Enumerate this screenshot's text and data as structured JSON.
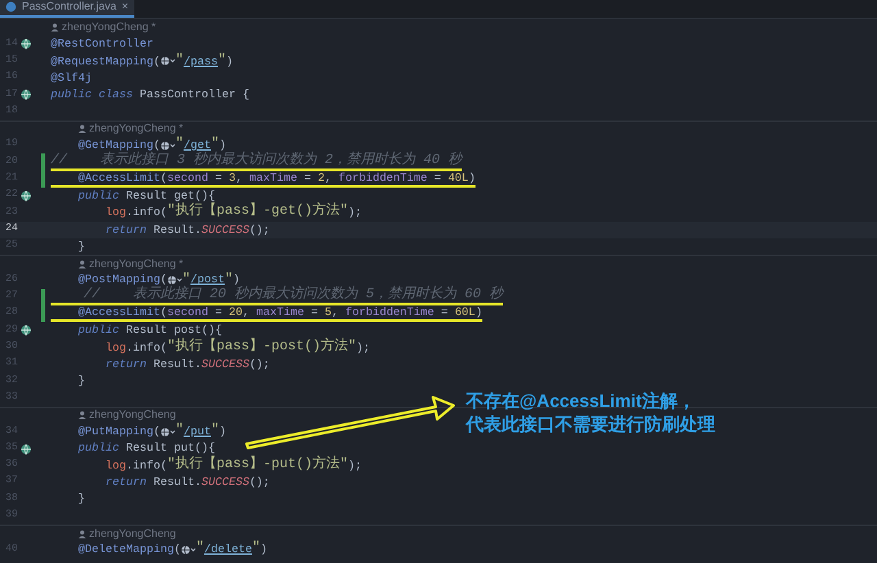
{
  "tab": {
    "title": "PassController.java",
    "close": "×"
  },
  "lines": [
    {
      "kind": "author",
      "text": "zhengYongCheng *"
    },
    {
      "kind": "code",
      "number": "14",
      "gutter_icon": true,
      "tokens": [
        {
          "kind": "annotation",
          "text": "@RestController"
        }
      ]
    },
    {
      "kind": "code",
      "number": "15",
      "tokens": [
        {
          "kind": "annotation",
          "text": "@RequestMapping"
        },
        {
          "kind": "plain",
          "text": "("
        },
        {
          "kind": "url_icon"
        },
        {
          "kind": "string",
          "text": "\""
        },
        {
          "kind": "link",
          "text": "/pass"
        },
        {
          "kind": "string",
          "text": "\""
        },
        {
          "kind": "plain",
          "text": ")"
        }
      ]
    },
    {
      "kind": "code",
      "number": "16",
      "tokens": [
        {
          "kind": "annotation",
          "text": "@Slf4j"
        }
      ]
    },
    {
      "kind": "code",
      "number": "17",
      "gutter_icon": true,
      "tokens": [
        {
          "kind": "keyword",
          "text": "public class "
        },
        {
          "kind": "plain",
          "text": "PassController {"
        }
      ]
    },
    {
      "kind": "code",
      "number": "18"
    },
    {
      "kind": "author",
      "text": "zhengYongCheng *"
    },
    {
      "kind": "code",
      "number": "19",
      "tokens": [
        {
          "kind": "annotation",
          "text": "    @GetMapping"
        },
        {
          "kind": "plain",
          "text": "("
        },
        {
          "kind": "url_icon"
        },
        {
          "kind": "string",
          "text": "\""
        },
        {
          "kind": "link",
          "text": "/get"
        },
        {
          "kind": "string",
          "text": "\""
        },
        {
          "kind": "plain",
          "text": ")"
        }
      ]
    },
    {
      "kind": "code",
      "number": "20",
      "changed": true,
      "underlined": true,
      "tokens": [
        {
          "kind": "comment",
          "text": "//    表示此接口 3 秒内最大访问次数为 2，禁用时长为 40 秒"
        }
      ]
    },
    {
      "kind": "code",
      "number": "21",
      "changed": true,
      "underlined": true,
      "tokens": [
        {
          "kind": "annotation",
          "text": "    @AccessLimit"
        },
        {
          "kind": "plain",
          "text": "("
        },
        {
          "kind": "param",
          "text": "second"
        },
        {
          "kind": "plain",
          "text": " = "
        },
        {
          "kind": "number",
          "text": "3"
        },
        {
          "kind": "plain",
          "text": ", "
        },
        {
          "kind": "param",
          "text": "maxTime"
        },
        {
          "kind": "plain",
          "text": " = "
        },
        {
          "kind": "number",
          "text": "2"
        },
        {
          "kind": "plain",
          "text": ", "
        },
        {
          "kind": "param",
          "text": "forbiddenTime"
        },
        {
          "kind": "plain",
          "text": " = "
        },
        {
          "kind": "number",
          "text": "40L"
        },
        {
          "kind": "plain",
          "text": ")"
        }
      ]
    },
    {
      "kind": "code",
      "number": "22",
      "gutter_icon": true,
      "tokens": [
        {
          "kind": "keyword",
          "text": "    public "
        },
        {
          "kind": "plain",
          "text": "Result get(){"
        }
      ]
    },
    {
      "kind": "code",
      "number": "23",
      "tokens": [
        {
          "kind": "field",
          "text": "        log"
        },
        {
          "kind": "plain",
          "text": ".info("
        },
        {
          "kind": "string",
          "text": "\"执行【pass】-get()方法\""
        },
        {
          "kind": "plain",
          "text": ");"
        }
      ]
    },
    {
      "kind": "code",
      "number": "24",
      "current": true,
      "tokens": [
        {
          "kind": "keyword",
          "text": "        return "
        },
        {
          "kind": "plain",
          "text": "Result."
        },
        {
          "kind": "constant",
          "text": "SUCCESS"
        },
        {
          "kind": "plain",
          "text": "();"
        }
      ]
    },
    {
      "kind": "code",
      "number": "25",
      "tokens": [
        {
          "kind": "plain",
          "text": "    }"
        }
      ]
    },
    {
      "kind": "author",
      "text": "zhengYongCheng *"
    },
    {
      "kind": "code",
      "number": "26",
      "tokens": [
        {
          "kind": "annotation",
          "text": "    @PostMapping"
        },
        {
          "kind": "plain",
          "text": "("
        },
        {
          "kind": "url_icon"
        },
        {
          "kind": "string",
          "text": "\""
        },
        {
          "kind": "link",
          "text": "/post"
        },
        {
          "kind": "string",
          "text": "\""
        },
        {
          "kind": "plain",
          "text": ")"
        }
      ]
    },
    {
      "kind": "code",
      "number": "27",
      "changed": true,
      "underlined": true,
      "tokens": [
        {
          "kind": "comment",
          "text": "    //    表示此接口 20 秒内最大访问次数为 5，禁用时长为 60 秒"
        }
      ]
    },
    {
      "kind": "code",
      "number": "28",
      "changed": true,
      "underlined": true,
      "tokens": [
        {
          "kind": "annotation",
          "text": "    @AccessLimit"
        },
        {
          "kind": "plain",
          "text": "("
        },
        {
          "kind": "param",
          "text": "second"
        },
        {
          "kind": "plain",
          "text": " = "
        },
        {
          "kind": "number",
          "text": "20"
        },
        {
          "kind": "plain",
          "text": ", "
        },
        {
          "kind": "param",
          "text": "maxTime"
        },
        {
          "kind": "plain",
          "text": " = "
        },
        {
          "kind": "number",
          "text": "5"
        },
        {
          "kind": "plain",
          "text": ", "
        },
        {
          "kind": "param",
          "text": "forbiddenTime"
        },
        {
          "kind": "plain",
          "text": " = "
        },
        {
          "kind": "number",
          "text": "60L"
        },
        {
          "kind": "plain",
          "text": ")"
        }
      ]
    },
    {
      "kind": "code",
      "number": "29",
      "gutter_icon": true,
      "tokens": [
        {
          "kind": "keyword",
          "text": "    public "
        },
        {
          "kind": "plain",
          "text": "Result post(){"
        }
      ]
    },
    {
      "kind": "code",
      "number": "30",
      "tokens": [
        {
          "kind": "field",
          "text": "        log"
        },
        {
          "kind": "plain",
          "text": ".info("
        },
        {
          "kind": "string",
          "text": "\"执行【pass】-post()方法\""
        },
        {
          "kind": "plain",
          "text": ");"
        }
      ]
    },
    {
      "kind": "code",
      "number": "31",
      "tokens": [
        {
          "kind": "keyword",
          "text": "        return "
        },
        {
          "kind": "plain",
          "text": "Result."
        },
        {
          "kind": "constant",
          "text": "SUCCESS"
        },
        {
          "kind": "plain",
          "text": "();"
        }
      ]
    },
    {
      "kind": "code",
      "number": "32",
      "tokens": [
        {
          "kind": "plain",
          "text": "    }"
        }
      ]
    },
    {
      "kind": "code",
      "number": "33"
    },
    {
      "kind": "author",
      "text": "zhengYongCheng"
    },
    {
      "kind": "code",
      "number": "34",
      "tokens": [
        {
          "kind": "annotation",
          "text": "    @PutMapping"
        },
        {
          "kind": "plain",
          "text": "("
        },
        {
          "kind": "url_icon"
        },
        {
          "kind": "string",
          "text": "\""
        },
        {
          "kind": "link",
          "text": "/put"
        },
        {
          "kind": "string",
          "text": "\""
        },
        {
          "kind": "plain",
          "text": ")"
        }
      ]
    },
    {
      "kind": "code",
      "number": "35",
      "gutter_icon": true,
      "tokens": [
        {
          "kind": "keyword",
          "text": "    public "
        },
        {
          "kind": "plain",
          "text": "Result put(){"
        }
      ]
    },
    {
      "kind": "code",
      "number": "36",
      "tokens": [
        {
          "kind": "field",
          "text": "        log"
        },
        {
          "kind": "plain",
          "text": ".info("
        },
        {
          "kind": "string",
          "text": "\"执行【pass】-put()方法\""
        },
        {
          "kind": "plain",
          "text": ");"
        }
      ]
    },
    {
      "kind": "code",
      "number": "37",
      "tokens": [
        {
          "kind": "keyword",
          "text": "        return "
        },
        {
          "kind": "plain",
          "text": "Result."
        },
        {
          "kind": "constant",
          "text": "SUCCESS"
        },
        {
          "kind": "plain",
          "text": "();"
        }
      ]
    },
    {
      "kind": "code",
      "number": "38",
      "tokens": [
        {
          "kind": "plain",
          "text": "    }"
        }
      ]
    },
    {
      "kind": "code",
      "number": "39"
    },
    {
      "kind": "author",
      "text": "zhengYongCheng"
    },
    {
      "kind": "code",
      "number": "40",
      "tokens": [
        {
          "kind": "annotation",
          "text": "    @DeleteMapping"
        },
        {
          "kind": "plain",
          "text": "("
        },
        {
          "kind": "url_icon"
        },
        {
          "kind": "string",
          "text": "\""
        },
        {
          "kind": "link",
          "text": "/delete"
        },
        {
          "kind": "string",
          "text": "\""
        },
        {
          "kind": "plain",
          "text": ")"
        }
      ]
    }
  ],
  "callout": {
    "lines": [
      "不存在@AccessLimit注解，",
      "代表此接口不需要进行防刷处理"
    ]
  }
}
